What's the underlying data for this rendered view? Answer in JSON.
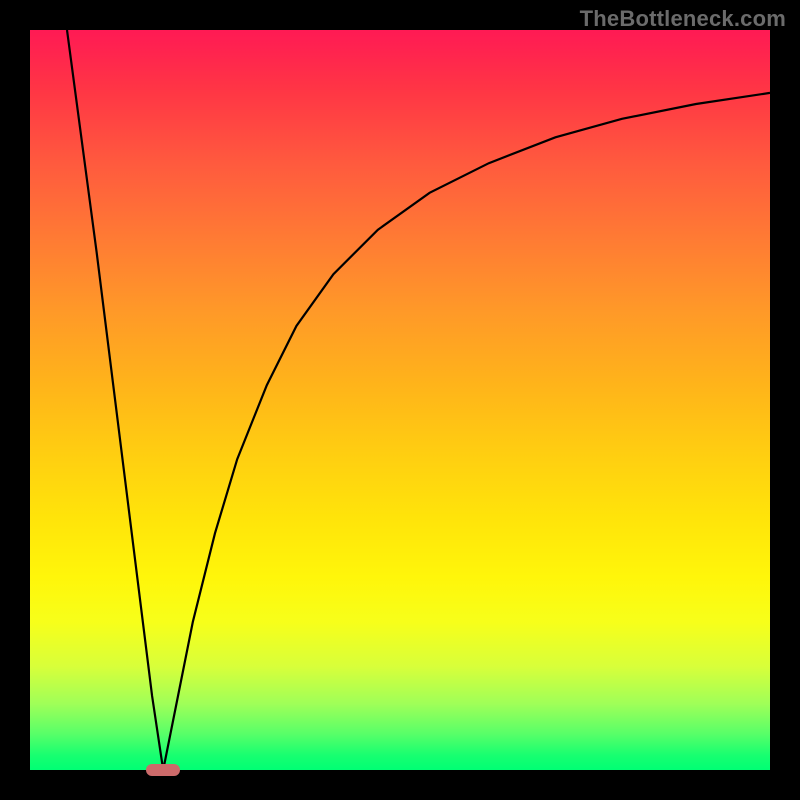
{
  "watermark": "TheBottleneck.com",
  "chart_data": {
    "type": "line",
    "title": "",
    "xlabel": "",
    "ylabel": "",
    "xlim": [
      0,
      100
    ],
    "ylim": [
      0,
      100
    ],
    "grid": false,
    "legend": false,
    "optimal_x": 18,
    "marker": {
      "x": 18,
      "y": 0,
      "color": "#cc6a6a"
    },
    "series": [
      {
        "name": "left-branch",
        "color": "#000000",
        "x": [
          5,
          7,
          9,
          11,
          13,
          15,
          16.5,
          18
        ],
        "y": [
          100,
          85,
          70,
          54,
          38,
          22,
          10,
          0
        ]
      },
      {
        "name": "right-branch",
        "color": "#000000",
        "x": [
          18,
          20,
          22,
          25,
          28,
          32,
          36,
          41,
          47,
          54,
          62,
          71,
          80,
          90,
          100
        ],
        "y": [
          0,
          10,
          20,
          32,
          42,
          52,
          60,
          67,
          73,
          78,
          82,
          85.5,
          88,
          90,
          91.5
        ]
      }
    ],
    "background_gradient": {
      "top": "#ff1a54",
      "mid": "#ffe40a",
      "bottom": "#00ff74"
    }
  }
}
